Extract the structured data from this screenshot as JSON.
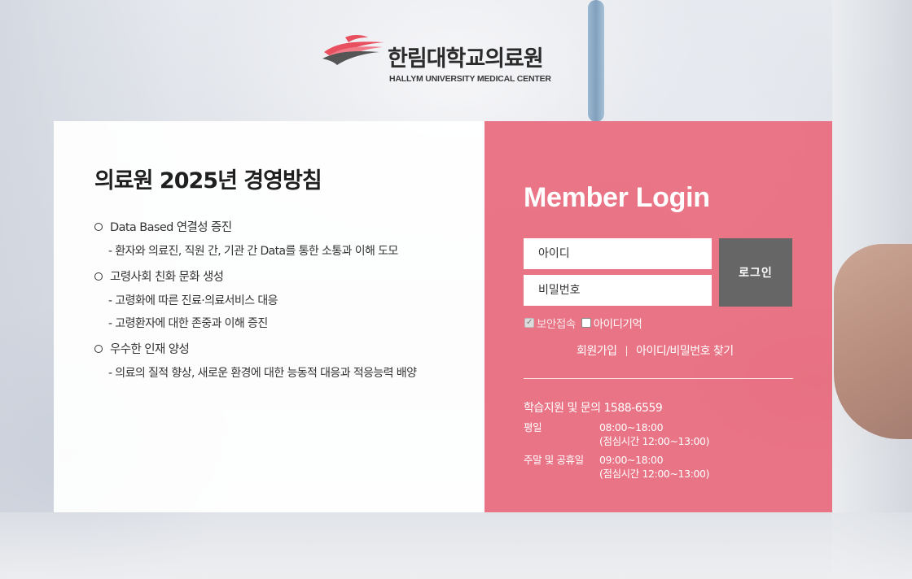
{
  "header": {
    "logo_ko": "한림대학교의료원",
    "logo_en": "HALLYM UNIVERSITY MEDICAL CENTER"
  },
  "policy": {
    "title": "의료원 2025년 경영방침",
    "items": [
      {
        "head": "Data Based 연결성 증진",
        "subs": [
          "- 환자와 의료진, 직원 간, 기관 간 Data를 통한 소통과 이해 도모"
        ]
      },
      {
        "head": "고령사회 친화 문화 생성",
        "subs": [
          "- 고령화에 따른 진료·의료서비스 대응",
          "- 고령환자에 대한 존중과 이해 증진"
        ]
      },
      {
        "head": "우수한 인재 양성",
        "subs": [
          "- 의료의 질적 향상, 새로운 환경에 대한 능동적 대응과 적응능력 배양"
        ]
      }
    ]
  },
  "login": {
    "title": "Member Login",
    "id_placeholder": "아이디",
    "pw_placeholder": "비밀번호",
    "button_label": "로그인",
    "secure_label": "보안접속",
    "remember_label": "아이디기억",
    "signup_label": "회원가입",
    "separator": "|",
    "find_label": "아이디/비밀번호 찾기"
  },
  "support": {
    "title": "학습지원 및 문의 1588-6559",
    "weekday_label": "평일",
    "weekday_time": "08:00~18:00",
    "weekday_lunch": "(점심시간 12:00~13:00)",
    "weekend_label": "주말 및 공휴일",
    "weekend_time": "09:00~18:00",
    "weekend_lunch": "(점심시간 12:00~13:00)"
  },
  "colors": {
    "panel_pink": "#ea6c7e",
    "login_button": "#666666",
    "logo_red": "#e8505f"
  }
}
